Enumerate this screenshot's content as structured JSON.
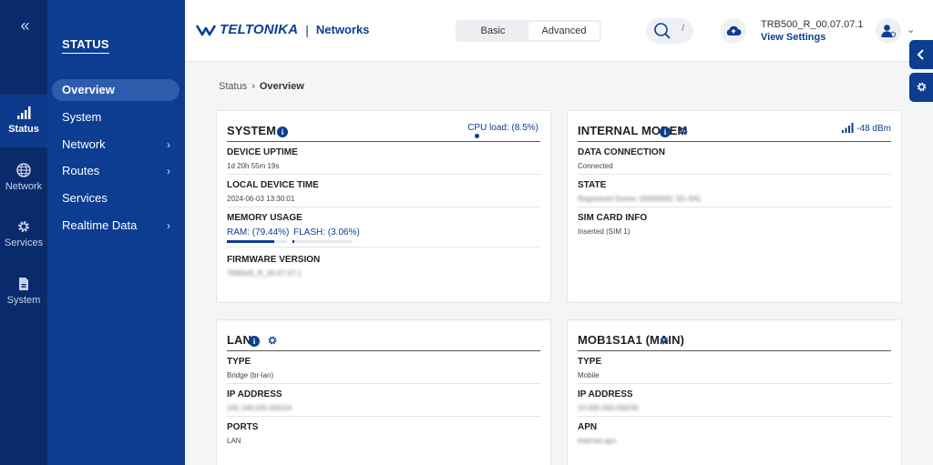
{
  "rail": {
    "items": [
      {
        "label": "Status",
        "icon": "signal-bars-icon"
      },
      {
        "label": "Network",
        "icon": "globe-icon"
      },
      {
        "label": "Services",
        "icon": "gear-icon"
      },
      {
        "label": "System",
        "icon": "document-icon"
      }
    ]
  },
  "nav": {
    "title": "STATUS",
    "items": [
      {
        "label": "Overview"
      },
      {
        "label": "System"
      },
      {
        "label": "Network"
      },
      {
        "label": "Routes"
      },
      {
        "label": "Services"
      },
      {
        "label": "Realtime Data"
      }
    ]
  },
  "header": {
    "brand": "TELTONIKA",
    "sub_brand": "Networks",
    "mode_basic": "Basic",
    "mode_advanced": "Advanced",
    "search_shortcut": "/",
    "device_name": "TRB500_R_00.07.07.1",
    "view_settings": "View Settings"
  },
  "breadcrumb": {
    "parent": "Status",
    "current": "Overview"
  },
  "system_card": {
    "title": "SYSTEM",
    "cpu_label": "CPU load: (8.5%)",
    "uptime_label": "DEVICE UPTIME",
    "uptime_value": "1d 20h 55m 19s",
    "time_label": "LOCAL DEVICE TIME",
    "time_value": "2024-06-03 13:30:01",
    "memory_label": "MEMORY USAGE",
    "ram_label": "RAM: (79.44%)",
    "flash_label": "FLASH: (3.06%)",
    "ram_percent": 79.44,
    "flash_percent": 3.06,
    "firmware_label": "FIRMWARE VERSION",
    "firmware_value": "TRB500_R_00.07.07.1"
  },
  "modem_card": {
    "title": "INTERNAL MODEM",
    "signal": "-48 dBm",
    "data_label": "DATA CONNECTION",
    "data_value": "Connected",
    "state_label": "STATE",
    "state_value": "Registered (home; 00000000; 5G-SA)",
    "sim_label": "SIM CARD INFO",
    "sim_value": "Inserted (SIM 1)"
  },
  "lan_card": {
    "title": "LAN",
    "type_label": "TYPE",
    "type_value": "Bridge (br-lan)",
    "ip_label": "IP ADDRESS",
    "ip_value": "192.168.000.000/24",
    "ports_label": "PORTS",
    "ports_value": "LAN"
  },
  "mob_card": {
    "title": "MOB1S1A1 (MAIN)",
    "type_label": "TYPE",
    "type_value": "Mobile",
    "ip_label": "IP ADDRESS",
    "ip_value": "10.000.000.000/30",
    "apn_label": "APN",
    "apn_value": "internet.apn"
  },
  "colors": {
    "primary": "#0c3d91",
    "rail": "#0a2b6b",
    "nav_active": "#2d5cad"
  }
}
